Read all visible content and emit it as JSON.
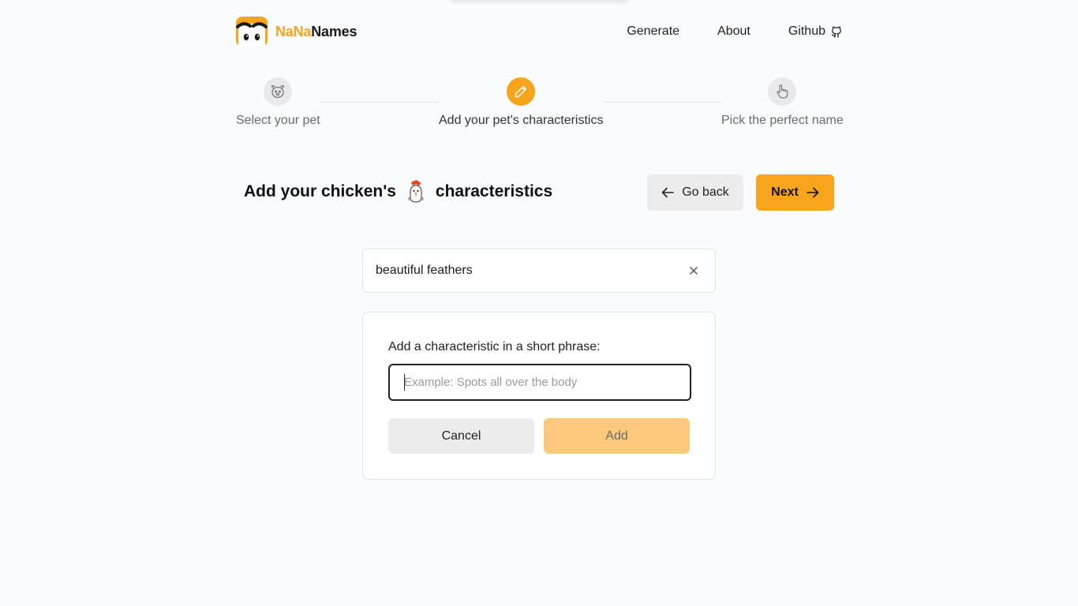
{
  "brand": {
    "part1": "NaNa",
    "part2": "Names",
    "accent_color": "#f9a41d"
  },
  "nav": {
    "generate": "Generate",
    "about": "About",
    "github": "Github",
    "github_icon": "github-icon"
  },
  "steps": [
    {
      "label": "Select your pet",
      "icon": "pet-face-icon",
      "active": false
    },
    {
      "label": "Add your pet's characteristics",
      "icon": "pencil-icon",
      "active": true
    },
    {
      "label": "Pick the perfect name",
      "icon": "pointer-hand-icon",
      "active": false
    }
  ],
  "heading": {
    "prefix": "Add your chicken's",
    "suffix": "characteristics",
    "icon": "chicken-icon"
  },
  "buttons": {
    "back": "Go back",
    "next": "Next"
  },
  "characteristics": [
    {
      "text": "beautiful feathers"
    }
  ],
  "form": {
    "label": "Add a characteristic in a short phrase:",
    "placeholder": "Example: Spots all over the body",
    "value": "",
    "cancel": "Cancel",
    "add": "Add"
  }
}
